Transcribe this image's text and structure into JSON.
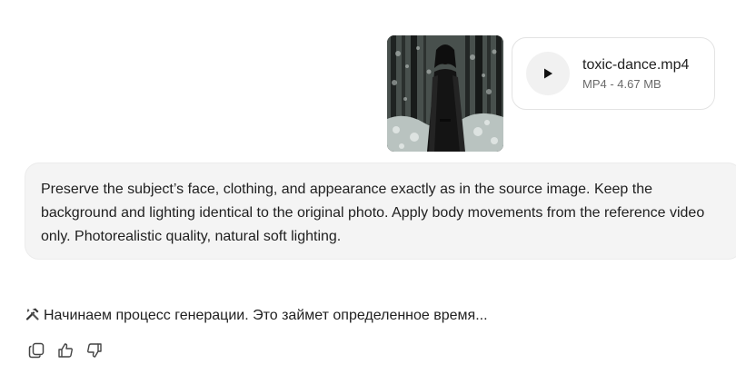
{
  "attachments": {
    "image": {
      "icon": "photo-thumbnail"
    },
    "file": {
      "name": "toxic-dance.mp4",
      "meta": "MP4 - 4.67 MB",
      "icon": "play-icon"
    }
  },
  "prompt": {
    "text": "Preserve the subject’s face, clothing, and appearance exactly as in the source image. Keep the background and lighting identical to the original photo. Apply body movements from the reference video only. Photorealistic quality, natural soft lighting."
  },
  "assistant": {
    "icon": "hammer-wrench-icon",
    "text": "Начинаем процесс генерации. Это займет определенное время..."
  },
  "actions": [
    {
      "name": "copy-icon"
    },
    {
      "name": "thumbs-up-icon"
    },
    {
      "name": "thumbs-down-icon"
    }
  ]
}
